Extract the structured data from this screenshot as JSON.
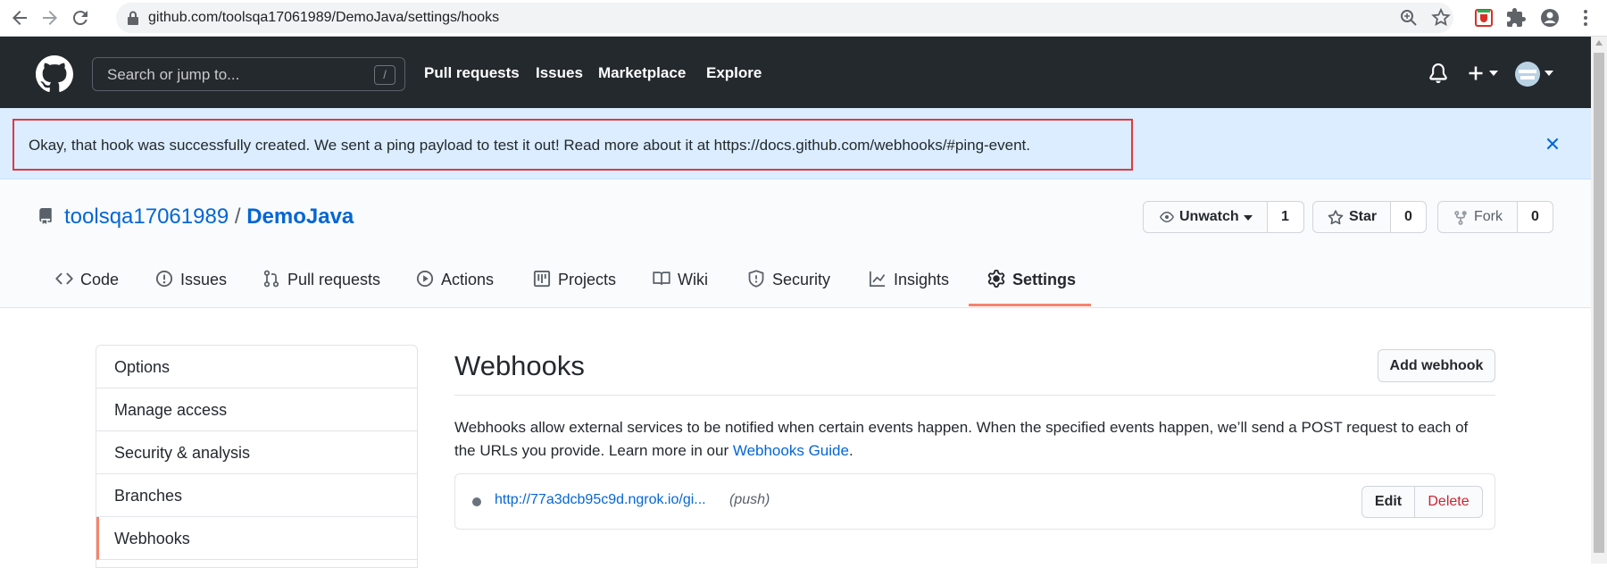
{
  "browser": {
    "url": "github.com/toolsqa17061989/DemoJava/settings/hooks",
    "icons": [
      "back-icon",
      "forward-icon",
      "reload-icon",
      "lock-icon",
      "zoom-icon",
      "star-icon",
      "extension-pdf-icon",
      "puzzle-icon",
      "profile-icon",
      "kebab-menu-icon"
    ]
  },
  "header": {
    "search_placeholder": "Search or jump to...",
    "search_shortcut": "/",
    "nav": [
      "Pull requests",
      "Issues",
      "Marketplace",
      "Explore"
    ]
  },
  "flash": {
    "message": "Okay, that hook was successfully created. We sent a ping payload to test it out! Read more about it at https://docs.github.com/webhooks/#ping-event."
  },
  "repo": {
    "owner": "toolsqa17061989",
    "separator": "/",
    "name": "DemoJava",
    "watch_label": "Unwatch",
    "watch_count": "1",
    "star_label": "Star",
    "star_count": "0",
    "fork_label": "Fork",
    "fork_count": "0"
  },
  "tabs": [
    {
      "label": "Code",
      "icon": "code-icon"
    },
    {
      "label": "Issues",
      "icon": "issue-icon"
    },
    {
      "label": "Pull requests",
      "icon": "pull-request-icon"
    },
    {
      "label": "Actions",
      "icon": "play-icon"
    },
    {
      "label": "Projects",
      "icon": "project-icon"
    },
    {
      "label": "Wiki",
      "icon": "book-icon"
    },
    {
      "label": "Security",
      "icon": "shield-icon"
    },
    {
      "label": "Insights",
      "icon": "graph-icon"
    },
    {
      "label": "Settings",
      "icon": "gear-icon",
      "selected": true
    }
  ],
  "sidebar": {
    "items": [
      "Options",
      "Manage access",
      "Security & analysis",
      "Branches",
      "Webhooks"
    ],
    "selected": "Webhooks"
  },
  "main": {
    "title": "Webhooks",
    "add_button": "Add webhook",
    "description_before_link": "Webhooks allow external services to be notified when certain events happen. When the specified events happen, we’ll send a POST request to each of the URLs you provide. Learn more in our ",
    "description_link": "Webhooks Guide",
    "description_after_link": ".",
    "hook": {
      "url": "http://77a3dcb95c9d.ngrok.io/gi...",
      "events": "(push)",
      "edit_label": "Edit",
      "delete_label": "Delete"
    }
  },
  "colors": {
    "header_bg": "#24292e",
    "flash_bg": "#dbedff",
    "highlight_border": "#e0393e",
    "link": "#0366d6",
    "tab_selected": "#f9826c",
    "danger": "#cb2431"
  }
}
